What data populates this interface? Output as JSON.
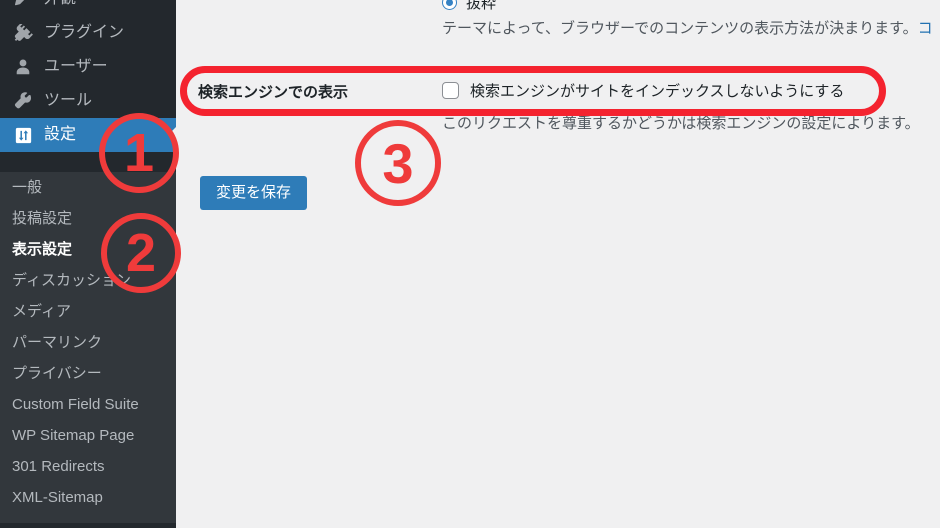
{
  "sidebar": {
    "menu": [
      {
        "label": "外観",
        "icon": "appearance-icon",
        "current": false
      },
      {
        "label": "プラグイン",
        "icon": "plugin-icon",
        "current": false
      },
      {
        "label": "ユーザー",
        "icon": "users-icon",
        "current": false
      },
      {
        "label": "ツール",
        "icon": "tools-icon",
        "current": false
      },
      {
        "label": "設定",
        "icon": "settings-icon",
        "current": true
      }
    ],
    "submenu": [
      {
        "label": "一般",
        "active": false
      },
      {
        "label": "投稿設定",
        "active": false
      },
      {
        "label": "表示設定",
        "active": true
      },
      {
        "label": "ディスカッション",
        "active": false
      },
      {
        "label": "メディア",
        "active": false
      },
      {
        "label": "パーマリンク",
        "active": false
      },
      {
        "label": "プライバシー",
        "active": false
      },
      {
        "label": "Custom Field Suite",
        "active": false
      },
      {
        "label": "WP Sitemap Page",
        "active": false
      },
      {
        "label": "301 Redirects",
        "active": false
      },
      {
        "label": "XML-Sitemap",
        "active": false
      }
    ]
  },
  "main": {
    "feed_radio": {
      "label": "抜粋",
      "checked": true
    },
    "theme_description": "テーマによって、ブラウザーでのコンテンツの表示方法が決まります。",
    "theme_description_link": "コ",
    "search_visibility": {
      "row_label": "検索エンジンでの表示",
      "checkbox_label": "検索エンジンがサイトをインデックスしないようにする",
      "checkbox_checked": false,
      "note": "このリクエストを尊重するかどうかは検索エンジンの設定によります。"
    },
    "save_label": "変更を保存"
  },
  "annotations": {
    "step1": "1",
    "step2": "2",
    "step3": "3"
  },
  "colors": {
    "sidebar_bg": "#23282d",
    "submenu_bg": "#32373c",
    "accent_blue": "#2e7cb8",
    "annotation_red": "#ef3b3b",
    "content_bg": "#f0f0f1",
    "link_blue": "#2271b1"
  }
}
